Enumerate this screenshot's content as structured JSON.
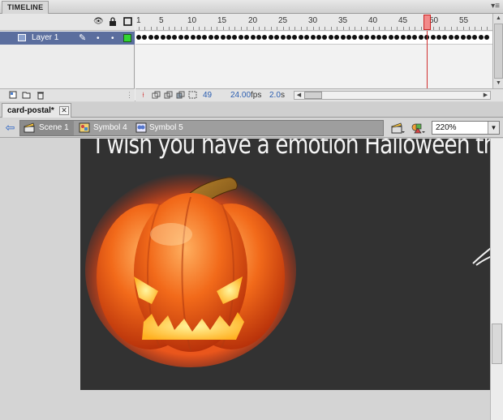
{
  "timeline": {
    "panel_title": "TIMELINE",
    "menu_glyph": "▾≡",
    "ruler_numbers": [
      "1",
      "5",
      "10",
      "15",
      "20",
      "25",
      "30",
      "35",
      "40",
      "45",
      "50",
      "55"
    ],
    "layer": {
      "name": "Layer 1",
      "visible_dot": "•",
      "lock_dot": "•"
    },
    "current_frame": "49",
    "fps": "24.00",
    "fps_unit": "fps",
    "elapsed": "2.0",
    "elapsed_unit": "s"
  },
  "document": {
    "tab_label": "card-postal*",
    "close_glyph": "✕"
  },
  "editbar": {
    "back_glyph": "⇦",
    "breadcrumbs": [
      {
        "label": "Scene 1",
        "icon": "scene-clapper-icon"
      },
      {
        "label": "Symbol 4",
        "icon": "graphic-symbol-icon"
      },
      {
        "label": "Symbol 5",
        "icon": "movieclip-symbol-icon"
      }
    ],
    "zoom": "220%"
  },
  "stage": {
    "text": "I wish you have a emotion Halloween th",
    "background": "#323232",
    "image": "jack-o-lantern pumpkin"
  }
}
